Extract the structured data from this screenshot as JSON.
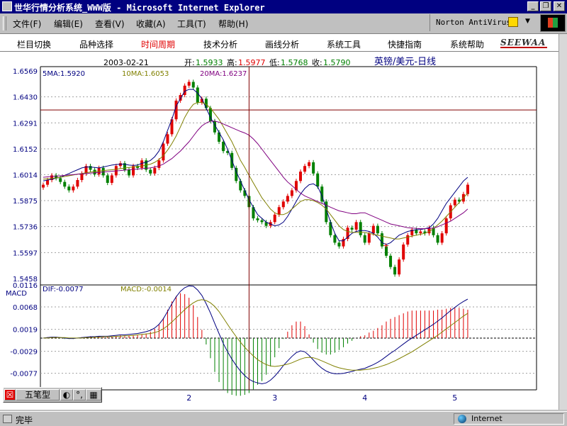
{
  "window": {
    "title": "世华行情分析系统_WWW版 - Microsoft Internet Explorer"
  },
  "menu": [
    "文件(F)",
    "编辑(E)",
    "查看(V)",
    "收藏(A)",
    "工具(T)",
    "帮助(H)"
  ],
  "norton": {
    "label": "Norton AntiVirus"
  },
  "app_toolbar": {
    "items": [
      "栏目切换",
      "品种选择",
      "时间周期",
      "技术分析",
      "画线分析",
      "系统工具",
      "快捷指南",
      "系统帮助"
    ],
    "active_index": 2,
    "logo": "SEEWAA"
  },
  "price_panel": {
    "date": "2003-02-21",
    "open_label": "开:",
    "open": "1.5933",
    "high_label": "高:",
    "high": "1.5977",
    "low_label": "低:",
    "low": "1.5768",
    "close_label": "收:",
    "close": "1.5790",
    "symbol": "英镑/美元-日线",
    "ma5": "5MA:1.5920",
    "ma10": "10MA:1.6053",
    "ma20": "20MA:1.6237"
  },
  "macd_panel": {
    "label": "MACD",
    "dif": "DIF:-0.0077",
    "macd": "MACD:-0.0014"
  },
  "x_labels": [
    "2",
    "3",
    "4",
    "5"
  ],
  "status": {
    "text": "完毕",
    "zone": "Internet"
  },
  "ime": {
    "label": "五笔型"
  },
  "colors": {
    "up": "#e00000",
    "down": "#008000",
    "ma5": "#000080",
    "ma10": "#808000",
    "ma20": "#800080",
    "crosshair": "#800000"
  },
  "chart_data": [
    {
      "type": "candlestick",
      "symbol": "英镑/美元-日线",
      "ylim": [
        1.5458,
        1.6569
      ],
      "yticks": [
        "1.6569",
        "1.6430",
        "1.6291",
        "1.6152",
        "1.6014",
        "1.5875",
        "1.5736",
        "1.5597",
        "1.5458"
      ],
      "reference_level": 1.636,
      "cursor_index": 48,
      "series": [
        {
          "name": "5MA",
          "values": [
            1.598,
            1.5985,
            1.599,
            1.5995,
            1.6,
            1.601,
            1.602,
            1.603,
            1.604,
            1.605,
            1.6055,
            1.6055,
            1.6052,
            1.605,
            1.6055,
            1.606,
            1.6065,
            1.6068,
            1.607,
            1.607,
            1.6065,
            1.6063,
            1.6065,
            1.6075,
            1.608,
            1.609,
            1.611,
            1.614,
            1.619,
            1.625,
            1.631,
            1.638,
            1.642,
            1.646,
            1.647,
            1.647,
            1.645,
            1.642,
            1.637,
            1.632,
            1.628,
            1.624,
            1.62,
            1.615,
            1.609,
            1.603,
            1.598,
            1.593,
            1.588,
            1.584,
            1.58,
            1.578,
            1.576,
            1.575,
            1.574,
            1.5745,
            1.576,
            1.579,
            1.583,
            1.587,
            1.591,
            1.594,
            1.596,
            1.5965,
            1.595,
            1.59,
            1.583,
            1.576,
            1.57,
            1.566,
            1.566,
            1.568,
            1.57,
            1.571,
            1.5715,
            1.5715,
            1.571,
            1.57,
            1.568,
            1.565,
            1.564,
            1.565,
            1.567,
            1.569,
            1.57,
            1.571,
            1.5715,
            1.572,
            1.572,
            1.5725,
            1.573,
            1.575,
            1.578,
            1.582,
            1.586,
            1.589,
            1.592,
            1.595,
            1.598,
            1.6
          ]
        },
        {
          "name": "10MA",
          "values": [
            1.599,
            1.5992,
            1.5994,
            1.5996,
            1.6,
            1.6004,
            1.6008,
            1.6012,
            1.6016,
            1.602,
            1.6024,
            1.6028,
            1.603,
            1.6033,
            1.6035,
            1.6038,
            1.604,
            1.6043,
            1.6046,
            1.6049,
            1.6052,
            1.6055,
            1.6058,
            1.606,
            1.6065,
            1.607,
            1.608,
            1.6095,
            1.6115,
            1.6145,
            1.618,
            1.622,
            1.627,
            1.632,
            1.636,
            1.639,
            1.64,
            1.64,
            1.639,
            1.637,
            1.634,
            1.631,
            1.627,
            1.623,
            1.619,
            1.614,
            1.609,
            1.6053,
            1.601,
            1.597,
            1.593,
            1.589,
            1.586,
            1.583,
            1.581,
            1.58,
            1.58,
            1.581,
            1.583,
            1.585,
            1.587,
            1.588,
            1.588,
            1.5875,
            1.5865,
            1.585,
            1.583,
            1.58,
            1.577,
            1.574,
            1.572,
            1.571,
            1.5705,
            1.5705,
            1.5705,
            1.5705,
            1.57,
            1.5695,
            1.569,
            1.5685,
            1.568,
            1.5675,
            1.567,
            1.567,
            1.5675,
            1.568,
            1.5685,
            1.569,
            1.5695,
            1.57,
            1.571,
            1.5725,
            1.5745,
            1.5765,
            1.579,
            1.5815,
            1.584,
            1.5865,
            1.589,
            1.5915
          ]
        },
        {
          "name": "20MA",
          "values": [
            1.6,
            1.6002,
            1.6004,
            1.6006,
            1.6008,
            1.601,
            1.6012,
            1.6014,
            1.6016,
            1.6018,
            1.602,
            1.6022,
            1.6024,
            1.6026,
            1.6028,
            1.603,
            1.6032,
            1.6034,
            1.6036,
            1.6038,
            1.604,
            1.6042,
            1.6044,
            1.6046,
            1.6048,
            1.605,
            1.6055,
            1.606,
            1.607,
            1.6085,
            1.61,
            1.612,
            1.614,
            1.6165,
            1.619,
            1.622,
            1.625,
            1.6275,
            1.629,
            1.63,
            1.63,
            1.6295,
            1.6285,
            1.6275,
            1.6265,
            1.6255,
            1.6245,
            1.6237,
            1.6225,
            1.6205,
            1.618,
            1.615,
            1.612,
            1.609,
            1.606,
            1.603,
            1.6,
            1.5975,
            1.5955,
            1.5935,
            1.5915,
            1.59,
            1.589,
            1.588,
            1.587,
            1.586,
            1.585,
            1.584,
            1.583,
            1.582,
            1.5815,
            1.581,
            1.5805,
            1.5805,
            1.581,
            1.581,
            1.58,
            1.579,
            1.578,
            1.577,
            1.576,
            1.575,
            1.5745,
            1.574,
            1.5735,
            1.573,
            1.5728,
            1.5726,
            1.5725,
            1.5725,
            1.5726,
            1.5728,
            1.5735,
            1.5745,
            1.5755,
            1.5765,
            1.578,
            1.5795,
            1.581,
            1.583
          ]
        }
      ],
      "close": [
        1.596,
        1.5985,
        1.601,
        1.5995,
        1.5975,
        1.595,
        1.593,
        1.595,
        1.5985,
        1.602,
        1.606,
        1.604,
        1.6015,
        1.605,
        1.601,
        1.597,
        1.601,
        1.606,
        1.6075,
        1.604,
        1.601,
        1.606,
        1.605,
        1.609,
        1.604,
        1.602,
        1.605,
        1.609,
        1.618,
        1.623,
        1.631,
        1.641,
        1.644,
        1.649,
        1.651,
        1.648,
        1.64,
        1.642,
        1.637,
        1.63,
        1.624,
        1.619,
        1.614,
        1.613,
        1.605,
        1.598,
        1.593,
        1.59,
        1.584,
        1.578,
        1.577,
        1.576,
        1.574,
        1.576,
        1.58,
        1.584,
        1.587,
        1.59,
        1.593,
        1.598,
        1.603,
        1.606,
        1.608,
        1.602,
        1.595,
        1.587,
        1.576,
        1.569,
        1.565,
        1.563,
        1.567,
        1.573,
        1.572,
        1.576,
        1.569,
        1.565,
        1.57,
        1.574,
        1.57,
        1.563,
        1.558,
        1.552,
        1.548,
        1.556,
        1.564,
        1.569,
        1.572,
        1.57,
        1.571,
        1.57,
        1.573,
        1.569,
        1.565,
        1.57,
        1.578,
        1.585,
        1.588,
        1.587,
        1.591,
        1.596
      ]
    }
  ],
  "macd_chart": {
    "type": "line+histogram",
    "ylim": [
      -0.011,
      0.0116
    ],
    "yticks": [
      "0.0116",
      "0.0068",
      "0.0019",
      "-0.0029",
      "-0.0077"
    ],
    "dif": [
      0.0,
      0.0001,
      0.0002,
      0.0002,
      0.0001,
      0.0,
      -0.0001,
      -0.0001,
      0.0,
      0.0001,
      0.0002,
      0.0003,
      0.0003,
      0.0004,
      0.0004,
      0.0004,
      0.0005,
      0.0006,
      0.0007,
      0.0007,
      0.0008,
      0.0009,
      0.001,
      0.0012,
      0.0014,
      0.0017,
      0.0022,
      0.003,
      0.0042,
      0.0058,
      0.0075,
      0.009,
      0.0102,
      0.011,
      0.0114,
      0.0113,
      0.0105,
      0.0093,
      0.0075,
      0.0055,
      0.0032,
      0.001,
      -0.0012,
      -0.003,
      -0.0046,
      -0.006,
      -0.0072,
      -0.0082,
      -0.009,
      -0.0095,
      -0.0098,
      -0.01,
      -0.0098,
      -0.0092,
      -0.0083,
      -0.0072,
      -0.006,
      -0.005,
      -0.004,
      -0.0032,
      -0.0028,
      -0.003,
      -0.0038,
      -0.0048,
      -0.0058,
      -0.0066,
      -0.0072,
      -0.0076,
      -0.0078,
      -0.0078,
      -0.0077,
      -0.0075,
      -0.0073,
      -0.007,
      -0.0068,
      -0.0066,
      -0.0062,
      -0.0058,
      -0.0053,
      -0.0047,
      -0.004,
      -0.0033,
      -0.0027,
      -0.002,
      -0.0013,
      -0.0006,
      0.0,
      0.0006,
      0.0012,
      0.0018,
      0.0024,
      0.003,
      0.0037,
      0.0044,
      0.0052,
      0.006,
      0.0067,
      0.0074,
      0.008,
      0.0085
    ],
    "dea": [
      0.0,
      0.0,
      0.0001,
      0.0001,
      0.0001,
      0.0001,
      0.0,
      0.0,
      0.0,
      0.0,
      0.0001,
      0.0001,
      0.0002,
      0.0002,
      0.0003,
      0.0003,
      0.0003,
      0.0004,
      0.0004,
      0.0005,
      0.0005,
      0.0006,
      0.0007,
      0.0008,
      0.0009,
      0.001,
      0.0012,
      0.0015,
      0.002,
      0.0027,
      0.0035,
      0.0044,
      0.0053,
      0.0062,
      0.007,
      0.0077,
      0.0082,
      0.0084,
      0.0082,
      0.0077,
      0.0069,
      0.0058,
      0.0044,
      0.003,
      0.0016,
      0.0003,
      -0.0009,
      -0.002,
      -0.003,
      -0.0039,
      -0.0047,
      -0.0053,
      -0.0058,
      -0.0061,
      -0.0062,
      -0.0061,
      -0.0059,
      -0.0057,
      -0.0054,
      -0.005,
      -0.0046,
      -0.0043,
      -0.0042,
      -0.0043,
      -0.0046,
      -0.005,
      -0.0054,
      -0.0058,
      -0.0062,
      -0.0065,
      -0.0067,
      -0.0069,
      -0.007,
      -0.007,
      -0.007,
      -0.0069,
      -0.0068,
      -0.0066,
      -0.0064,
      -0.0061,
      -0.0058,
      -0.0054,
      -0.005,
      -0.0045,
      -0.004,
      -0.0035,
      -0.003,
      -0.0024,
      -0.0018,
      -0.0012,
      -0.0006,
      0.0,
      0.0006,
      0.0013,
      0.002,
      0.0027,
      0.0034,
      0.0041,
      0.0048,
      0.0054
    ]
  }
}
